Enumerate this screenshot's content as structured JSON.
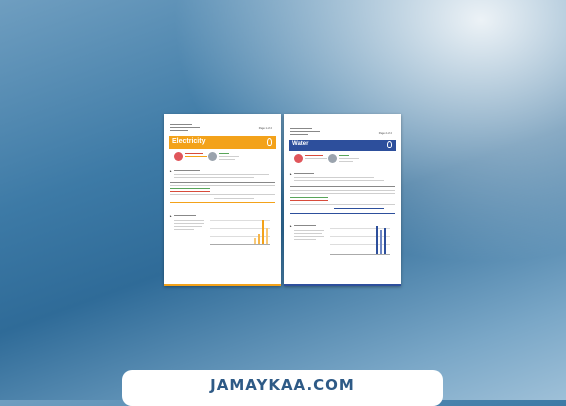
{
  "documents": {
    "electricity": {
      "section_title": "Electricity",
      "page_label": "Page 1 of 2",
      "colors": {
        "accent": "#f3a21a"
      }
    },
    "water": {
      "section_title": "Water",
      "page_label": "Page 2 of 2",
      "colors": {
        "accent": "#2d4f9c"
      }
    }
  },
  "banner": {
    "text": "JAMAYKAA.COM"
  },
  "colors": {
    "background_start": "#6f9ec0",
    "background_mid": "#2f6b98",
    "banner_text": "#2e5a86"
  }
}
